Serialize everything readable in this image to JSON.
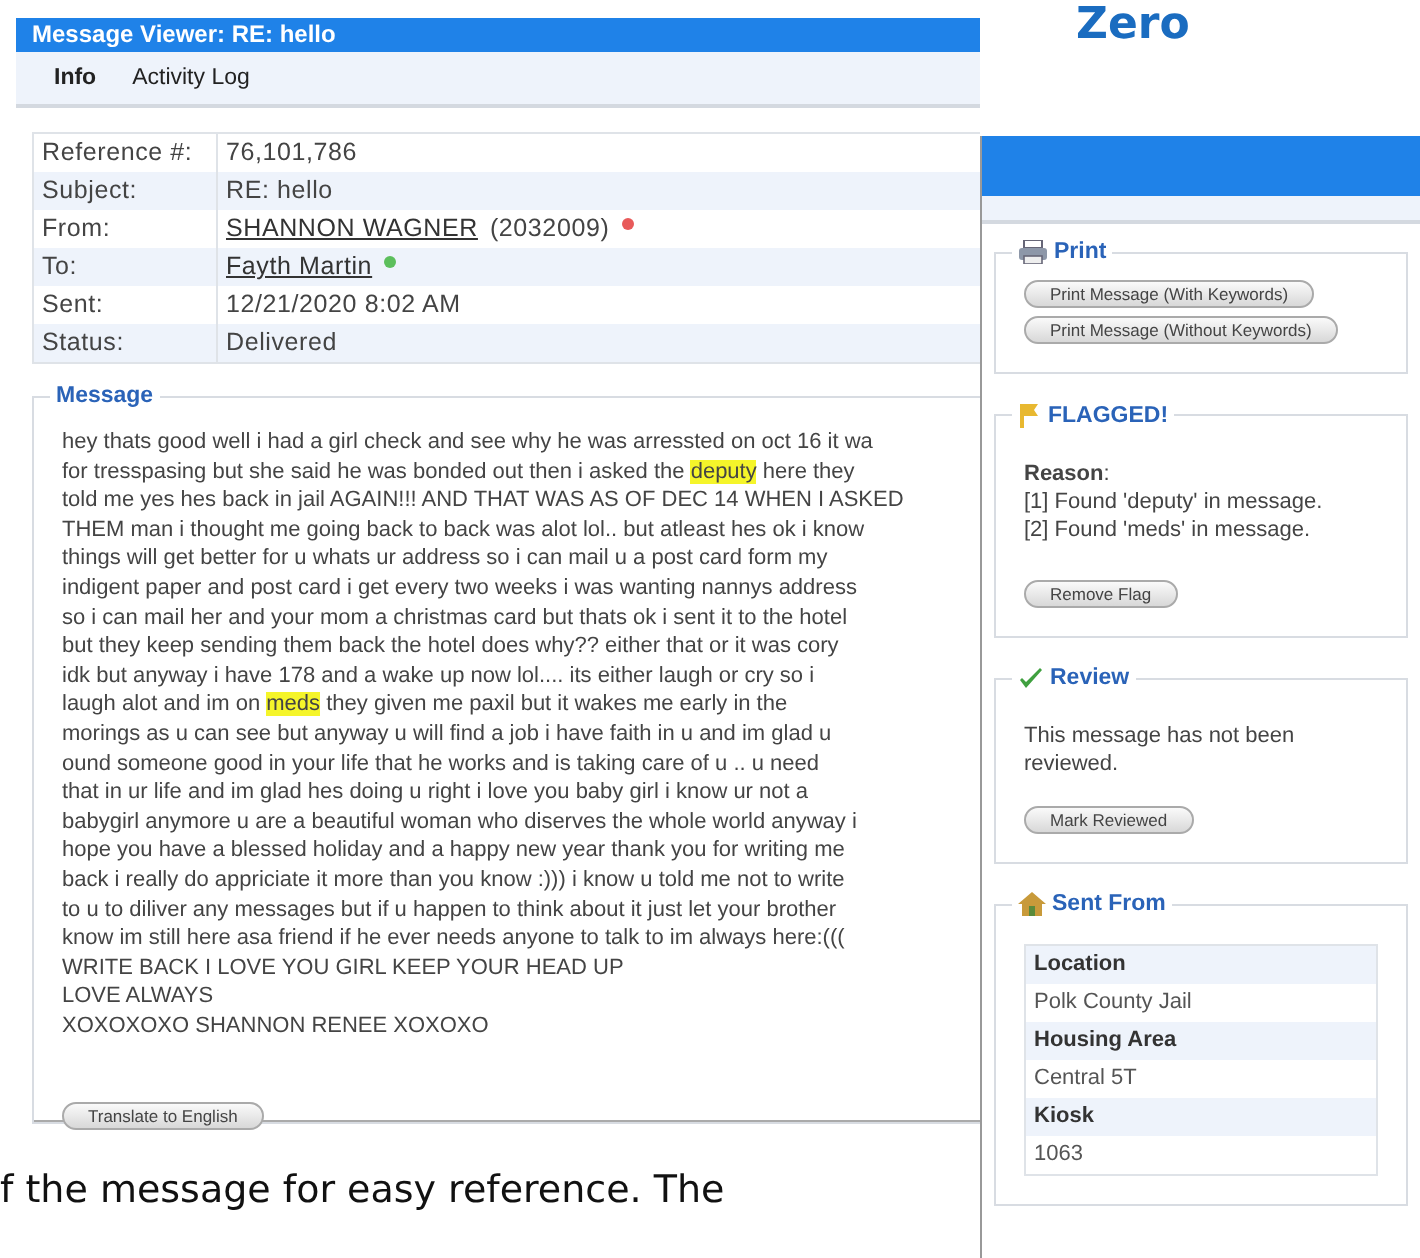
{
  "brand": {
    "text": "Zero"
  },
  "viewer": {
    "title": "Message Viewer: RE: hello",
    "tabs": [
      {
        "label": "Info",
        "selected": true
      },
      {
        "label": "Activity Log",
        "selected": false
      }
    ],
    "details": [
      {
        "label": "Reference #:",
        "kind": "text",
        "value": "76,101,786"
      },
      {
        "label": "Subject:",
        "kind": "text",
        "value": "RE: hello"
      },
      {
        "label": "From:",
        "kind": "link",
        "value": "SHANNON WAGNER",
        "suffix": "(2032009)",
        "color": "#e85a5a"
      },
      {
        "label": "To:",
        "kind": "link",
        "value": "Fayth Martin",
        "color": "#5cbf5c"
      },
      {
        "label": "Sent:",
        "kind": "text",
        "value": "12/21/2020 8:02 AM"
      },
      {
        "label": "Status:",
        "kind": "text",
        "value": "Delivered"
      }
    ],
    "message": {
      "legend": "Message",
      "lines": [
        "hey thats good well i had a girl check and see why he was arressted on oct 16 it wa",
        "for tresspasing but she said he was bonded out then i asked the **deputy** here they",
        "told me yes hes back in jail AGAIN!!! AND THAT WAS AS OF DEC 14 WHEN I ASKED",
        "THEM man i thought me going back to back was alot lol.. but atleast hes ok i know",
        "things will get better for u whats ur address so i can mail u a post card form my",
        "indigent paper and post card i get every two weeks i was wanting nannys address",
        "so i can mail her and your mom a christmas card but thats ok i sent it to the hotel",
        "but they keep sending them back the hotel does why?? either that or it was cory",
        "idk but anyway i have 178 and a wake up now lol.... its either laugh or cry so i",
        "laugh alot and im on **meds** they given me paxil but it wakes me early in the",
        "morings as u can see but anyway u will find a job i have faith in u and im glad u",
        "ound someone good in your life that he works and is taking care of u .. u need",
        "that in ur life and im glad hes doing u right i love you baby girl i know ur not a",
        "babygirl anymore u are a beautiful woman who diserves the whole world anyway i",
        "hope you have a blessed holiday and a happy new year thank you for writing me",
        "back i really do appriciate it more than you know :))) i know u told me not to write",
        "to u to diliver any messages but if u happen to think about it just let your brother",
        "know im still here asa friend if he ever needs anyone to talk to im always here:(((",
        "WRITE BACK I LOVE YOU GIRL KEEP YOUR HEAD UP",
        "LOVE ALWAYS",
        "XOXOXOXO SHANNON RENEE XOXOXO"
      ],
      "button": "Translate to English"
    }
  },
  "caption": "f the message for easy reference. The",
  "sidebar": {
    "sections": [
      {
        "kind": "print",
        "legend": "Print",
        "buttons": [
          "Print Message (With Keywords)",
          "Print Message (Without Keywords)"
        ]
      },
      {
        "kind": "flag",
        "legend": "FLAGGED!",
        "reason": "**Reason**:",
        "reasons": [
          "[1] Found 'deputy' in message.",
          "[2] Found 'meds' in message."
        ],
        "buttons": [
          "Remove Flag"
        ]
      },
      {
        "kind": "review",
        "legend": "Review",
        "note": "This message has not been reviewed.",
        "buttons": [
          "Mark Reviewed"
        ]
      },
      {
        "kind": "origin",
        "legend": "Sent From",
        "fields": [
          {
            "label": "Location",
            "value": "Polk County Jail"
          },
          {
            "label": "Housing Area",
            "value": "Central 5T"
          },
          {
            "label": "Kiosk",
            "value": "1063"
          }
        ]
      }
    ]
  }
}
